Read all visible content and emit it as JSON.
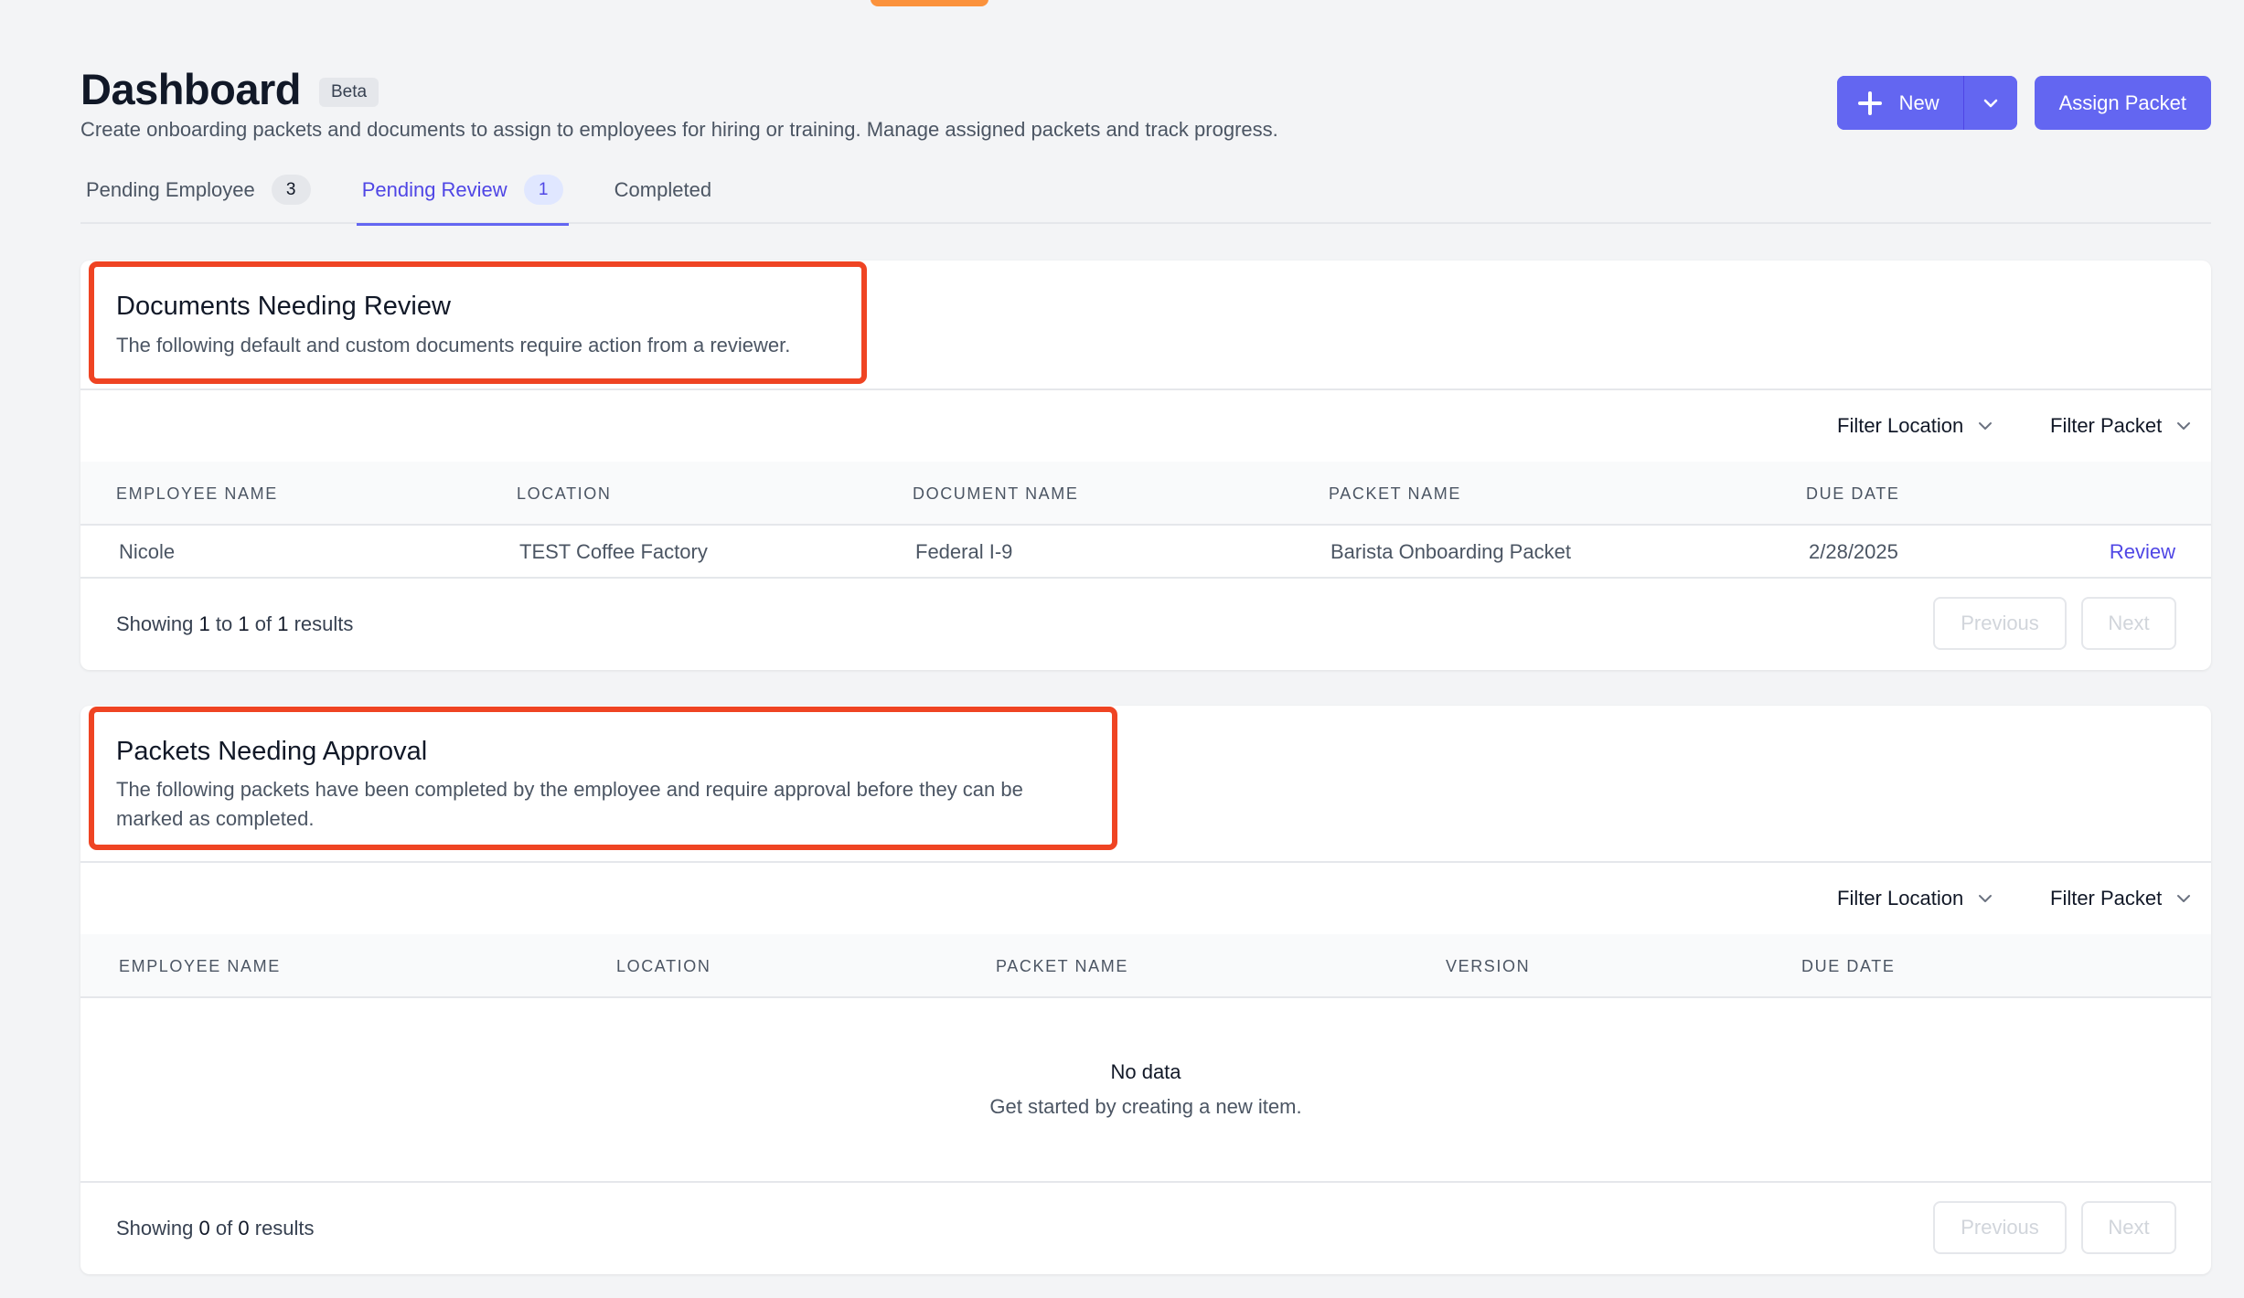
{
  "header": {
    "title": "Dashboard",
    "badge": "Beta",
    "description": "Create onboarding packets and documents to assign to employees for hiring or training. Manage assigned packets and track progress.",
    "new_label": "New",
    "assign_label": "Assign Packet"
  },
  "tabs": [
    {
      "label": "Pending Employee",
      "count": "3",
      "active": false
    },
    {
      "label": "Pending Review",
      "count": "1",
      "active": true
    },
    {
      "label": "Completed",
      "active": false
    }
  ],
  "documents_section": {
    "title": "Documents Needing Review",
    "subtitle": "The following default and custom documents require action from a reviewer.",
    "filters": {
      "location": "Filter Location",
      "packet": "Filter Packet"
    },
    "columns": [
      "EMPLOYEE NAME",
      "LOCATION",
      "DOCUMENT NAME",
      "PACKET NAME",
      "DUE DATE"
    ],
    "rows": [
      {
        "employee": "Nicole",
        "location": "TEST Coffee Factory",
        "document": "Federal I-9",
        "packet": "Barista Onboarding Packet",
        "due": "2/28/2025",
        "action": "Review"
      }
    ],
    "footer": {
      "prefix": "Showing",
      "from": "1",
      "to_word": "to",
      "to": "1",
      "of_word": "of",
      "total": "1",
      "suffix": "results"
    },
    "previous": "Previous",
    "next": "Next"
  },
  "packets_section": {
    "title": "Packets Needing Approval",
    "subtitle_line1": "The following packets have been completed by the employee and require approval before they can be",
    "subtitle_line2": "marked as completed.",
    "filters": {
      "location": "Filter Location",
      "packet": "Filter Packet"
    },
    "columns": [
      "EMPLOYEE NAME",
      "LOCATION",
      "PACKET NAME",
      "VERSION",
      "DUE DATE"
    ],
    "empty_title": "No data",
    "empty_subtitle": "Get started by creating a new item.",
    "footer": {
      "prefix": "Showing",
      "count": "0",
      "of_word": "of",
      "total": "0",
      "suffix": "results"
    },
    "previous": "Previous",
    "next": "Next"
  },
  "colors": {
    "accent": "#6366f1",
    "highlight": "#ef4423",
    "top_badge": "#fb923c"
  }
}
